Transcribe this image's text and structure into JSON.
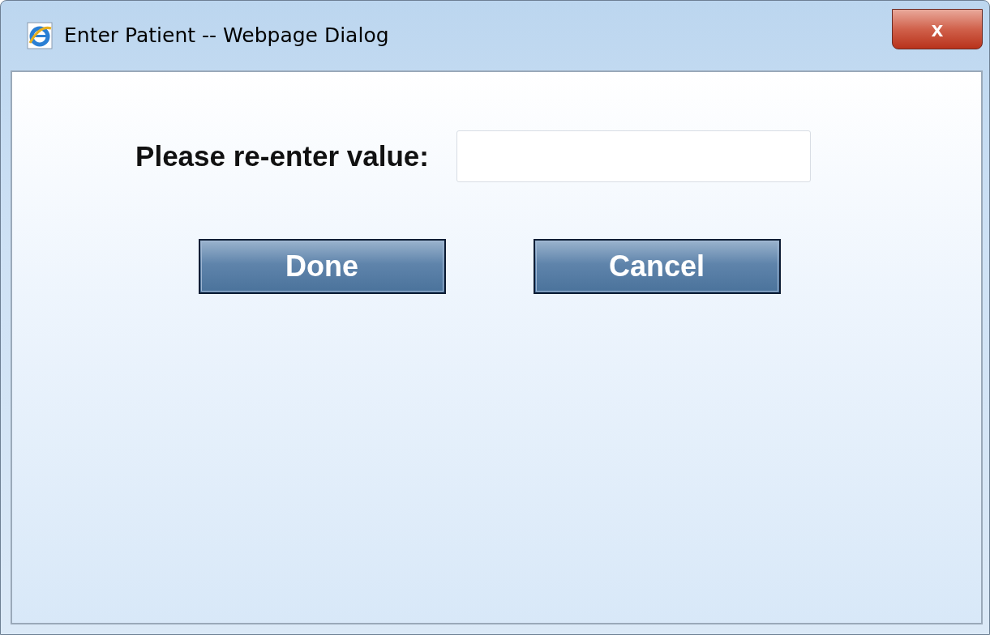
{
  "window": {
    "title": "Enter Patient -- Webpage Dialog",
    "close_label": "x"
  },
  "form": {
    "label": "Please re-enter value:"
  },
  "buttons": [
    {
      "label": "Done"
    },
    {
      "label": "Cancel"
    }
  ]
}
